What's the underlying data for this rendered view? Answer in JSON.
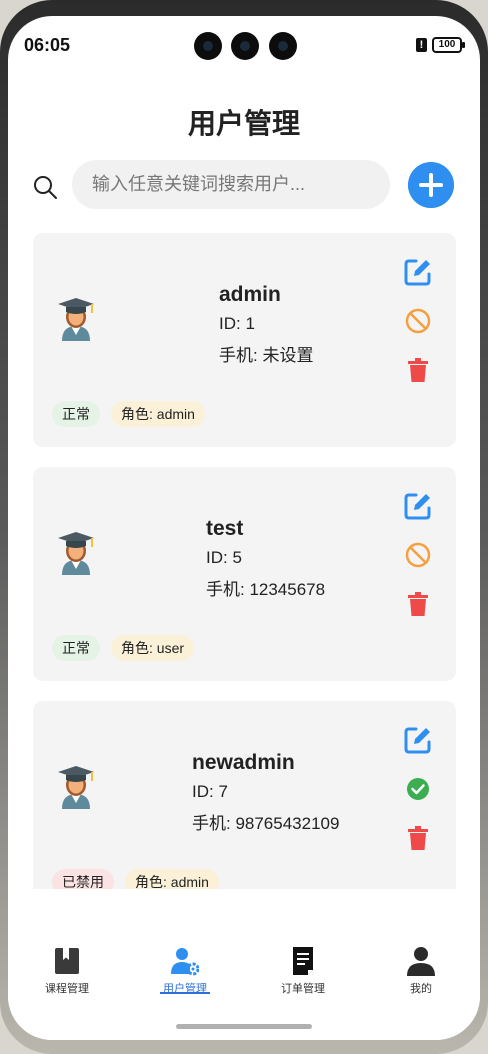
{
  "status": {
    "time": "06:05",
    "battery": "100",
    "alert": "!"
  },
  "header": {
    "title": "用户管理"
  },
  "search": {
    "placeholder": "输入任意关键词搜索用户..."
  },
  "users": [
    {
      "name": "admin",
      "id": "ID: 1",
      "phone": "手机: 未设置",
      "status": "正常",
      "role": "角色: admin",
      "state": "normal"
    },
    {
      "name": "test",
      "id": "ID: 5",
      "phone": "手机: 12345678",
      "status": "正常",
      "role": "角色: user",
      "state": "normal"
    },
    {
      "name": "newadmin",
      "id": "ID: 7",
      "phone": "手机: 98765432109",
      "status": "已禁用",
      "role": "角色: admin",
      "state": "disabled"
    }
  ],
  "tabs": [
    {
      "label": "课程管理",
      "icon": "book-icon"
    },
    {
      "label": "用户管理",
      "icon": "user-settings-icon",
      "active": true
    },
    {
      "label": "订单管理",
      "icon": "document-icon"
    },
    {
      "label": "我的",
      "icon": "person-icon"
    }
  ],
  "colors": {
    "accent": "#2e8ff1",
    "edit": "#2e8ff1",
    "ban": "#f5a040",
    "delete": "#ef4a4a",
    "enable": "#3cae4f",
    "tab_active": "#2e6fd6"
  }
}
